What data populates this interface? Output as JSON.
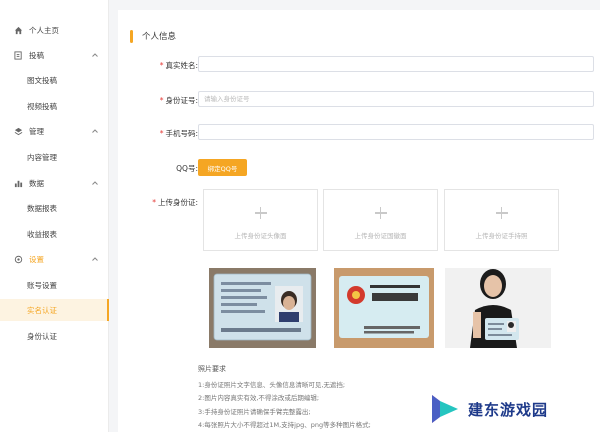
{
  "sidebar": {
    "items": [
      {
        "label": "个人主页",
        "icon": "home-icon"
      },
      {
        "label": "投稿",
        "icon": "edit-icon"
      },
      {
        "label": "图文投稿"
      },
      {
        "label": "视频投稿"
      },
      {
        "label": "管理",
        "icon": "layers-icon"
      },
      {
        "label": "内容管理"
      },
      {
        "label": "数据",
        "icon": "bar-chart-icon"
      },
      {
        "label": "数据报表"
      },
      {
        "label": "收益报表"
      },
      {
        "label": "设置",
        "icon": "settings-icon"
      },
      {
        "label": "账号设置"
      },
      {
        "label": "实名认证"
      },
      {
        "label": "身份认证"
      }
    ]
  },
  "section": {
    "title": "个人信息"
  },
  "form": {
    "name_label": "真实姓名:",
    "idnum_label": "身份证号:",
    "idnum_placeholder": "请输入身份证号",
    "phone_label": "手机号码:",
    "qq_label": "QQ号:",
    "qq_button": "绑定QQ号",
    "upload_label": "上传身份证:",
    "uploads": [
      "上传身份证头像面",
      "上传身份证国徽面",
      "上传身份证手持照"
    ]
  },
  "notes": {
    "title": "照片要求",
    "lines": [
      "1:身份证照片文字信息、头像信息清晰可见,无遮挡;",
      "2:图片内容真实有效,不得涂改或后期编辑;",
      "3:手持身份证照片请确保手臂完整露出;",
      "4:每张照片大小不得超过1M,支持jpg、png等多种图片格式;"
    ]
  },
  "watermark": {
    "text": "建东游戏园"
  },
  "colors": {
    "accent": "#f5a623",
    "required": "#e53935"
  }
}
